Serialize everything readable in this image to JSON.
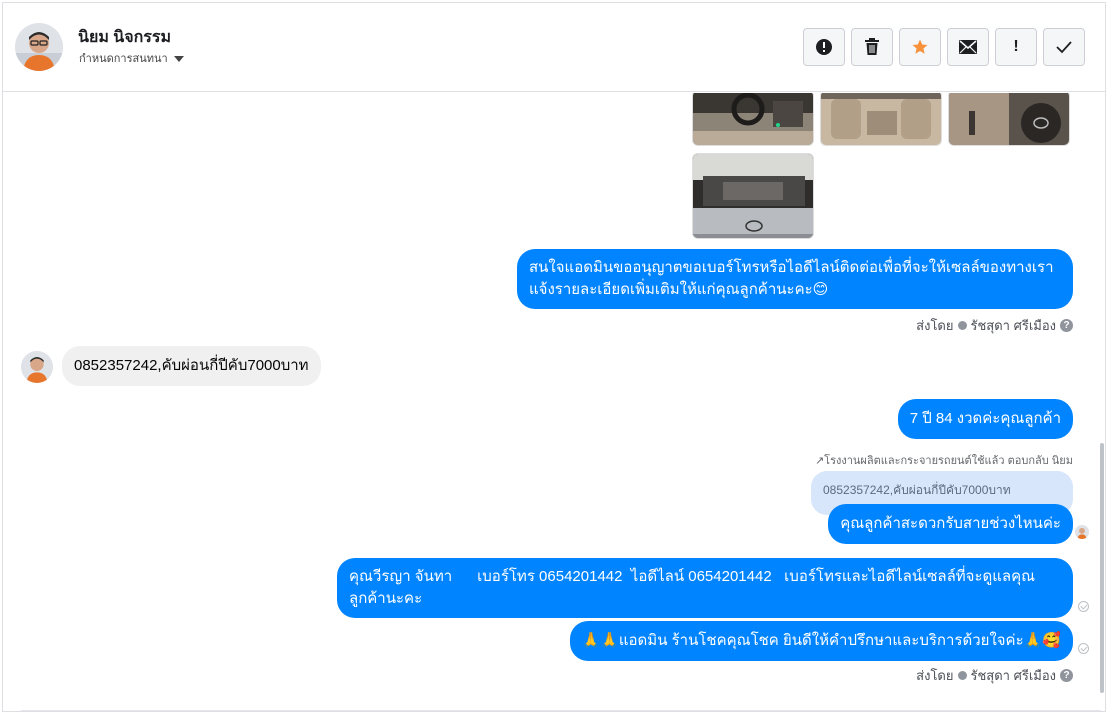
{
  "header": {
    "contact_name": "นิยม นิจกรรม",
    "assign_label": "กำหนดการสนทนา",
    "actions": [
      {
        "name": "spam-button",
        "icon": "alert-circle-icon"
      },
      {
        "name": "delete-button",
        "icon": "trash-icon"
      },
      {
        "name": "star-button",
        "icon": "star-icon",
        "color": "#f7923b"
      },
      {
        "name": "mail-button",
        "icon": "mail-icon"
      },
      {
        "name": "follow-up-button",
        "icon": "exclamation-icon",
        "glyph": "!"
      },
      {
        "name": "done-button",
        "icon": "check-icon"
      }
    ]
  },
  "messages": {
    "m1": "สนใจแอดมินขออนุญาตขอเบอร์โทรหรือไอดีไลน์ติดต่อเพื่อที่จะให้เซลล์ของทางเรา",
    "m1b": "แจ้งรายละเอียดเพิ่มเติมให้แก่คุณลูกค้านะคะ😊",
    "sent_by_1": "ส่งโดย",
    "agent_1": "รัชสุดา ศรีเมือง",
    "in1": "0852357242,คับผ่อนกี่ปีคับ7000บาท",
    "m2": "7 ปี 84 งวดค่ะคุณลูกค้า",
    "reply_note": "โรงงานผลิตและกระจายรถยนต์ใช้แล้ว ตอบกลับ นิยม",
    "quoted": "0852357242,คับผ่อนกี่ปีคับ7000บาท",
    "m3": "คุณลูกค้าสะดวกรับสายช่วงไหนค่ะ",
    "m4": "คุณวีรญา จันทา      เบอร์โทร 0654201442  ไอดีไลน์ 0654201442   เบอร์โทรและไอดีไลน์เซลล์ที่จะดูแลคุณ",
    "m4b": "ลูกค้านะคะ",
    "m5": "🙏🙏แอดมิน ร้านโชคคุณโชค ยินดีให้คำปรึกษาและบริการด้วยใจค่ะ🙏🥰",
    "sent_by_2": "ส่งโดย",
    "agent_2": "รัชสุดา ศรีเมือง",
    "help": "?"
  },
  "colors": {
    "outgoing": "#0084ff",
    "incoming": "#f0f0f0",
    "quoted": "#d7e6fb",
    "star": "#f7923b"
  }
}
